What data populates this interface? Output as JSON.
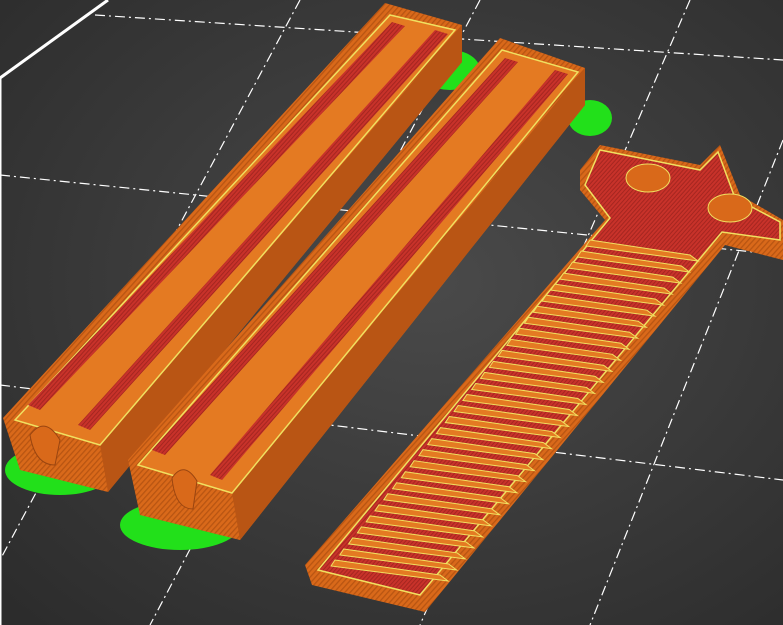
{
  "viewport": {
    "mode": "slicer-preview",
    "objects": [
      "bar-part-1",
      "bar-part-2",
      "comb-part"
    ]
  },
  "colors": {
    "background": "#3c3c3c",
    "perimeter": "#e0701c",
    "infill": "#c8322a",
    "skirt": "#22e01a",
    "gap_fill": "#f0e060",
    "grid": "#ffffff"
  }
}
